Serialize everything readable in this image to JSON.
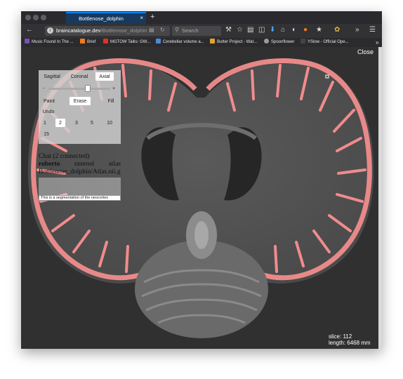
{
  "browser": {
    "tab_title": "Bottlenose_dolphin",
    "tab_close": "×",
    "new_tab": "+",
    "url_host": "braincatalogue.dev",
    "url_path": "/Bottlenose_dolphin",
    "search_placeholder": "Search",
    "colors": {
      "tab_accent": "#0a84ff",
      "chrome_dark": "#2a2a2e",
      "toolbar": "#323234"
    }
  },
  "bookmarks": [
    {
      "label": "Music Found In The ...",
      "icon": "pp-icon",
      "color": "#7b4fb8"
    },
    {
      "label": "Brief",
      "icon": "rss-icon",
      "color": "#f27a1a"
    },
    {
      "label": "MGTOW Talks: GW...",
      "icon": "youtube-icon",
      "color": "#e52d27"
    },
    {
      "label": "Cerebellar volume a...",
      "icon": "doc-icon",
      "color": "#4a8bd6"
    },
    {
      "label": "Butter Project - Wat...",
      "icon": "butter-icon",
      "color": "#e3a22c"
    },
    {
      "label": "Spoonflower",
      "icon": "spoonflower-icon",
      "color": "#9a9a9a"
    },
    {
      "label": "YSlow - Official Ope...",
      "icon": "yslow-icon",
      "color": "#444444"
    }
  ],
  "viewer": {
    "close_label": "Close",
    "slice_text": "slice: 112",
    "length_text": "length: 6468 mm",
    "segmentation_color": "#f08c8c"
  },
  "panel": {
    "views": [
      "Sagittal",
      "Coronal",
      "Axial"
    ],
    "selected_view": "Axial",
    "minus_label": "-",
    "plus_label": "+",
    "slider_value": 0.72,
    "tools": [
      "Paint",
      "Erase",
      "Fill"
    ],
    "selected_tool": "Erase",
    "undo_label": "Undo",
    "sizes": [
      "1",
      "2",
      "3",
      "5",
      "10",
      "15"
    ],
    "selected_size": "2"
  },
  "chat": {
    "title": "Chat (2 connected)",
    "user": "roberto",
    "word1": "entered",
    "word2": "atlas",
    "path": "Bottlenose_dolphin/Atlas.nii.gz",
    "input_value": "This is a segmentation of the neocortex"
  }
}
